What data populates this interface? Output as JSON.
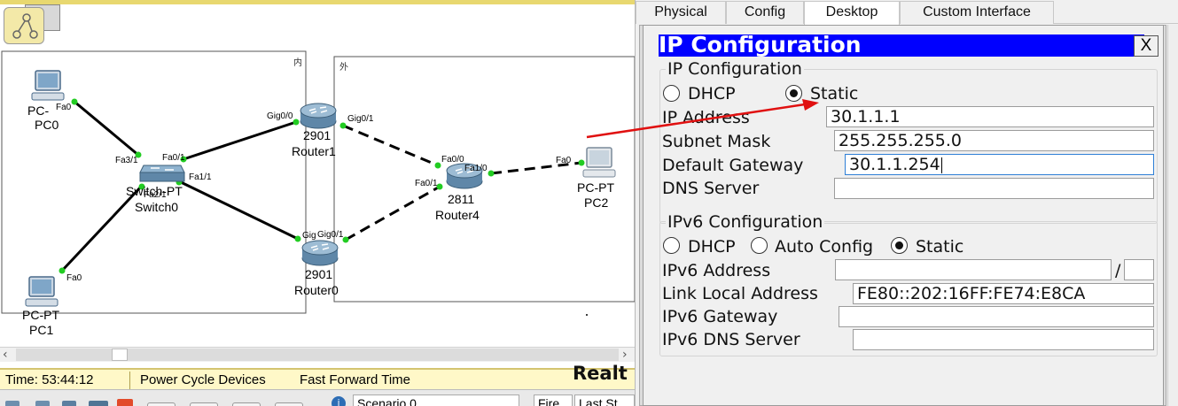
{
  "workspace": {
    "clusters": {
      "inner": "内",
      "outer": "外"
    },
    "devices": {
      "pc0": {
        "type": "PC-",
        "name": "PC0"
      },
      "pc1": {
        "type": "PC-PT",
        "name": "PC1"
      },
      "pc2": {
        "type": "PC-PT",
        "name": "PC2"
      },
      "switch0": {
        "type": "Switch-PT",
        "name": "Switch0"
      },
      "router1": {
        "type": "2901",
        "name": "Router1"
      },
      "router0": {
        "type": "2901",
        "name": "Router0"
      },
      "router4": {
        "type": "2811",
        "name": "Router4"
      }
    },
    "ports": {
      "pc0_fa0": "Fa0",
      "pc1_fa0": "Fa0",
      "pc2_fa0": "Fa0",
      "sw_fa3_1": "Fa3/1",
      "sw_fa0_1": "Fa0/1",
      "sw_fa1_1": "Fa1/1",
      "sw_fa2_1": "Fa2/1",
      "r1_gig0_0": "Gig0/0",
      "r1_gig0_1": "Gig0/1",
      "r0_gig0_0": "Gig",
      "r0_gig0_1": "Gig0/1",
      "r4_fa0_0": "Fa0/0",
      "r4_fa0_1": "Fa0/1",
      "r4_fa1_0": "Fa1/0"
    },
    "status": {
      "time": "Time: 53:44:12",
      "power_cycle": "Power Cycle Devices",
      "fast_forward": "Fast Forward Time",
      "realtime": "Realt"
    },
    "bottom": {
      "scenario": "Scenario 0",
      "fire": "Fire",
      "last_status": "Last St"
    }
  },
  "panel": {
    "tabs": [
      {
        "label": "Physical"
      },
      {
        "label": "Config"
      },
      {
        "label": "Desktop"
      },
      {
        "label": "Custom Interface"
      }
    ],
    "active_tab": "Desktop",
    "window_title": "IP Configuration",
    "close_label": "X",
    "ipv4": {
      "group_title": "IP Configuration",
      "dhcp_label": "DHCP",
      "static_label": "Static",
      "mode": "Static",
      "ip_address_label": "IP Address",
      "ip_address": "30.1.1.1",
      "subnet_mask_label": "Subnet Mask",
      "subnet_mask": "255.255.255.0",
      "default_gateway_label": "Default Gateway",
      "default_gateway": "30.1.1.254",
      "dns_server_label": "DNS Server",
      "dns_server": ""
    },
    "ipv6": {
      "group_title": "IPv6 Configuration",
      "dhcp_label": "DHCP",
      "auto_config_label": "Auto Config",
      "static_label": "Static",
      "mode": "Static",
      "ipv6_address_label": "IPv6 Address",
      "ipv6_address": "",
      "prefix_separator": "/",
      "prefix_length": "",
      "link_local_label": "Link Local Address",
      "link_local": "FE80::202:16FF:FE74:E8CA",
      "ipv6_gateway_label": "IPv6 Gateway",
      "ipv6_gateway": "",
      "ipv6_dns_label": "IPv6 DNS Server",
      "ipv6_dns": ""
    }
  },
  "colors": {
    "title_bar": "#0000ff",
    "annotation_arrow": "#e01010",
    "link_up": "#22cc22",
    "status_bar": "#fff8c8"
  }
}
